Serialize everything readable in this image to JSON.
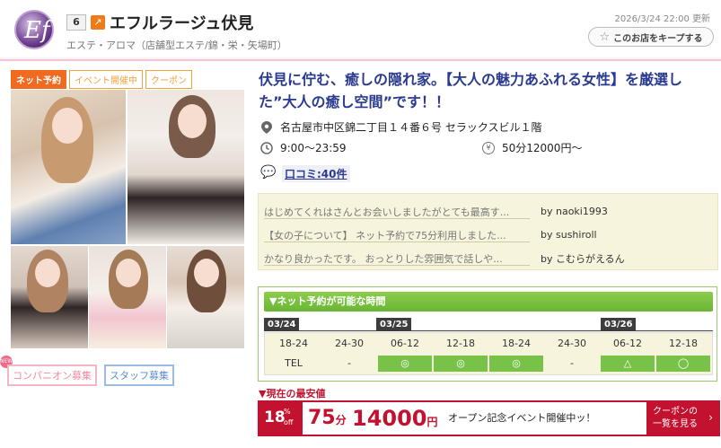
{
  "header": {
    "rank": "6",
    "shop_name": "エフルラージュ伏見",
    "category": "エステ・アロマ（店舗型エステ/錦・栄・矢場町）",
    "updated": "2026/3/24 22:00 更新",
    "keep_label": "このお店をキープする",
    "logo_text": "Ef"
  },
  "tags": [
    "ネット予約",
    "イベント開催中",
    "クーポン"
  ],
  "recruit": {
    "companion": "コンパニオン募集",
    "staff": "スタッフ募集"
  },
  "main": {
    "catch": "伏見に佇む、癒しの隠れ家。【大人の魅力あふれる女性】を厳選した”大人の癒し空間”です！！",
    "address": "名古屋市中区錦二丁目１４番６号 セラックスビル１階",
    "hours": "9:00〜23:59",
    "price": "50分12000円〜",
    "reviews_link": "口コミ:40件"
  },
  "reviews": [
    {
      "text": "はじめてくれはさんとお会いしましたがとても最高す...",
      "by": "by naoki1993"
    },
    {
      "text": "【女の子について】 ネット予約で75分利用しました...",
      "by": "by sushiroll"
    },
    {
      "text": "かなり良かったです。 おっとりした雰囲気で話しや...",
      "by": "by こむらがえるん"
    }
  ],
  "schedule": {
    "title": "▼ネット予約が可能な時間",
    "dates": [
      "03/24",
      "03/25",
      "03/26"
    ],
    "times": [
      "18-24",
      "24-30",
      "06-12",
      "12-18",
      "18-24",
      "24-30",
      "06-12",
      "12-18"
    ],
    "slots": [
      "TEL",
      "-",
      "◎",
      "◎",
      "◎",
      "-",
      "△",
      "◯"
    ]
  },
  "lowest": {
    "label": "▼現在の最安値",
    "off_num": "18",
    "off_pct": "%",
    "off_word": "off",
    "minutes": "75",
    "minutes_unit": "分",
    "yen": "14000",
    "yen_unit": "円",
    "event": "オープン記念イベント開催中ッ！",
    "coupon_line1": "クーポンの",
    "coupon_line2": "一覧を見る",
    "chevron": "›"
  },
  "colors": {
    "accent_red": "#c3122f",
    "catch_blue": "#2a3b8f",
    "tag_orange": "#f06a1f",
    "schedule_green": "#79c24a"
  }
}
